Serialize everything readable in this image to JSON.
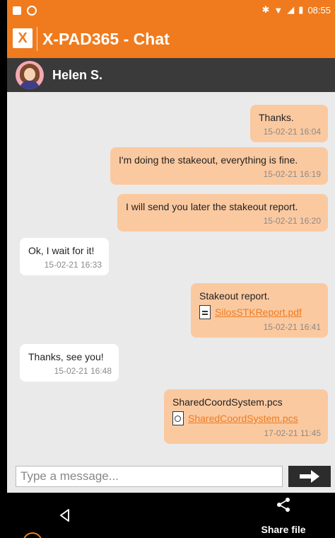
{
  "status_bar": {
    "time": "08:55"
  },
  "app_bar": {
    "title": "X-PAD365 - Chat",
    "logo_text": "X"
  },
  "contact": {
    "name": "Helen S."
  },
  "messages": [
    {
      "text": "Thanks.",
      "time": "15-02-21 16:04"
    },
    {
      "text": "I'm doing the stakeout, everything is fine.",
      "time": "15-02-21 16:19"
    },
    {
      "text": "I will send you later the stakeout report.",
      "time": "15-02-21 16:20"
    },
    {
      "text": "Ok, I wait for it!",
      "time": "15-02-21 16:33"
    },
    {
      "text": "Stakeout report.",
      "file": "SilosSTKReport.pdf",
      "time": "15-02-21 16:41"
    },
    {
      "text": "Thanks, see you!",
      "time": "15-02-21 16:48"
    },
    {
      "text": "SharedCoordSystem.pcs",
      "file": "SharedCoordSystem.pcs",
      "time": "17-02-21 11:45"
    }
  ],
  "composer": {
    "placeholder": "Type a message..."
  },
  "nav": {
    "share_label": "Share file"
  },
  "colors": {
    "accent": "#ef7b1e",
    "outgoing_bubble": "#fbc9a0",
    "incoming_bubble": "#ffffff",
    "header_dark": "#3a3a3a"
  },
  "icons": {
    "logo": "xpad-logo",
    "pdf": "document-icon",
    "pcs": "coordinate-file-icon",
    "send": "send-arrow-icon",
    "back": "back-triangle-icon",
    "share": "share-icon"
  }
}
